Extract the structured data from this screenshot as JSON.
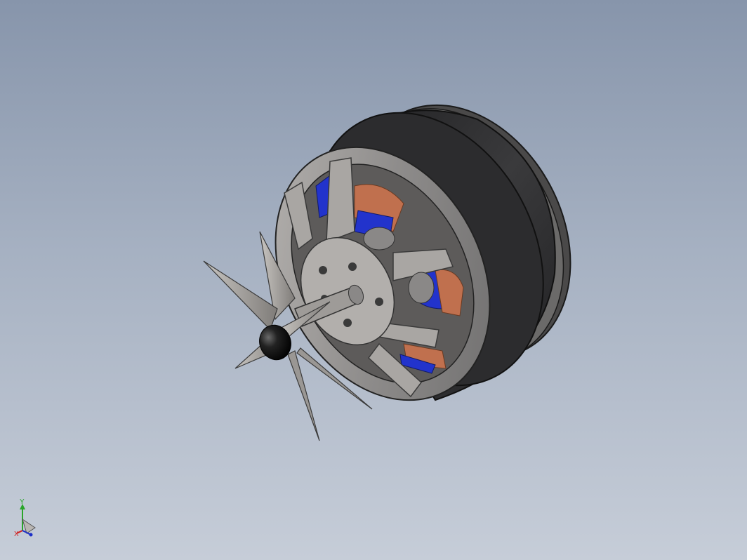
{
  "viewport": {
    "model": "outrunner-motor-with-propeller",
    "colors": {
      "background_top": "#8795ab",
      "background_bottom": "#c6cdd8",
      "motor_can": "#2f2f31",
      "bell_metal": "#8e8c8b",
      "stator_insulation": "#2233cc",
      "copper_winding": "#c0704e",
      "spinner": "#151515"
    }
  },
  "triad": {
    "y_label": "Y",
    "x_label": "X",
    "colors": {
      "y": "#2aa52a",
      "x": "#d02020",
      "z": "#1c2fc8"
    }
  }
}
